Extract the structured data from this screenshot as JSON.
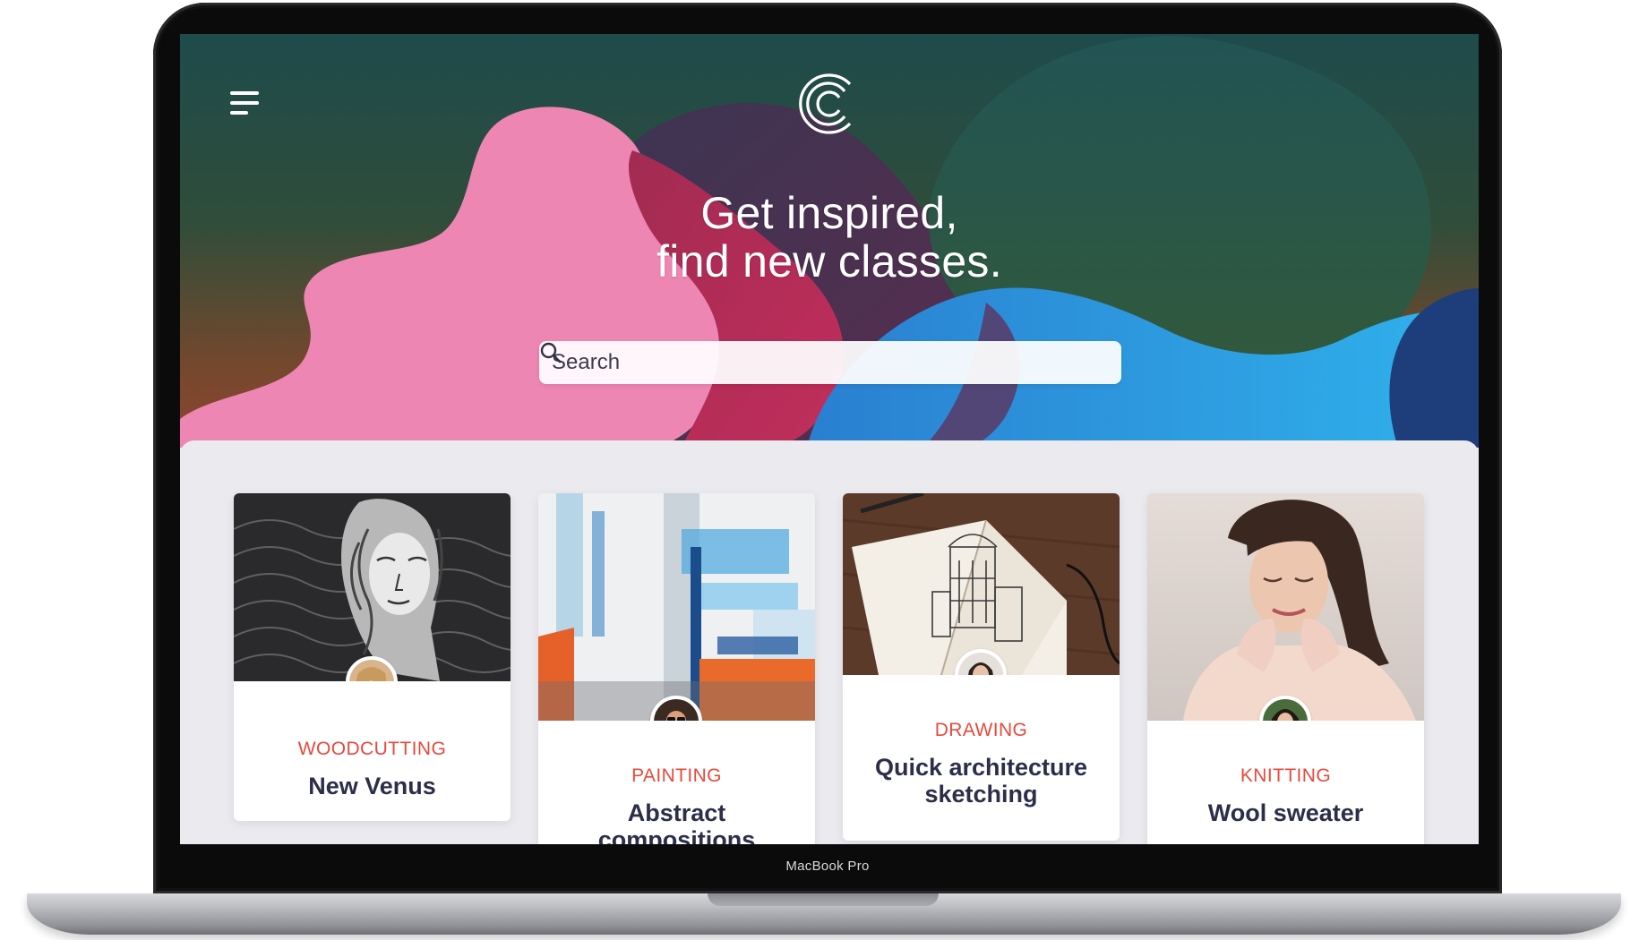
{
  "device": {
    "label": "MacBook Pro"
  },
  "header": {
    "menu_icon": "hamburger-menu-icon",
    "logo_icon": "brand-logo-c-icon",
    "title_line1": "Get inspired,",
    "title_line2": "find new classes."
  },
  "search": {
    "placeholder": "Search",
    "icon": "search-icon"
  },
  "colors": {
    "accent": "#e8493c",
    "title_text": "#2c2e4a",
    "pink_blob": "#ee86b3",
    "blue_blob": "#2ea8e3",
    "background": "#ebebef"
  },
  "classes": [
    {
      "category": "WOODCUTTING",
      "title": "New Venus"
    },
    {
      "category": "PAINTING",
      "title": "Abstract compositions"
    },
    {
      "category": "DRAWING",
      "title": "Quick architecture sketching"
    },
    {
      "category": "KNITTING",
      "title": "Wool sweater"
    }
  ]
}
